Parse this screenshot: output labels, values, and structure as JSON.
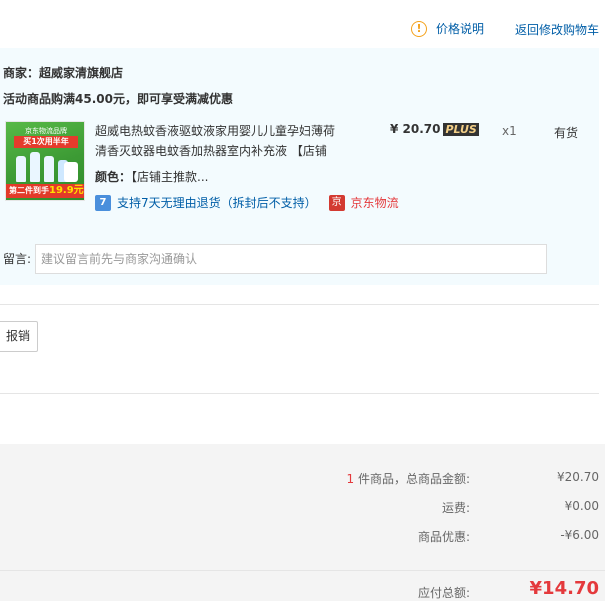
{
  "header": {
    "price_note": "价格说明",
    "back_to_cart": "返回修改购物车"
  },
  "store": {
    "merchant_label": "商家：",
    "merchant_name": "超威家清旗舰店",
    "promo": "活动商品购满45.00元，即可享受满减优惠"
  },
  "product": {
    "thumb_top": "京东物流品牌",
    "thumb_banner": "买1次用半年",
    "thumb_bottom_prefix": "第二件到手",
    "thumb_bottom_price": "19.9元",
    "title_line1": "超威电热蚊香液驱蚊液家用婴儿儿童孕妇薄荷",
    "title_line2": "清香灭蚊器电蚊香加热器室内补充液 【店铺",
    "price": "¥ 20.70",
    "plus_badge": "PLUS",
    "qty": "x1",
    "stock": "有货",
    "color_label": "颜色：",
    "color_value": "【店铺主推款...",
    "return_icon": "7",
    "return_policy": "支持7天无理由退货（拆封后不支持）",
    "jd_icon": "京",
    "logistics": "京东物流"
  },
  "message": {
    "label": "留言:",
    "placeholder": "建议留言前先与商家沟通确认"
  },
  "invoice": {
    "button_label": "报销"
  },
  "summary": {
    "count": "1",
    "count_label": " 件商品，总商品金额:",
    "goods_total": "¥20.70",
    "shipping_label": "运费:",
    "shipping": "¥0.00",
    "discount_label": "商品优惠:",
    "discount": "-¥6.00",
    "payable_label": "应付总额:",
    "payable": "¥14.70"
  },
  "colors": {
    "link": "#005ea7",
    "accent_red": "#e4393c",
    "panel_bg": "#f3fbfe"
  }
}
